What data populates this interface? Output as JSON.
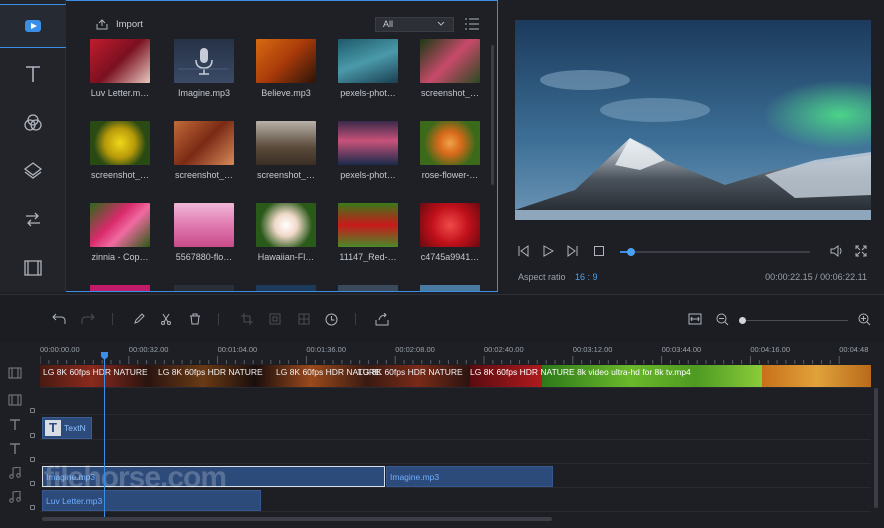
{
  "media": {
    "import_label": "Import",
    "filter": "All",
    "items": [
      {
        "name": "Luv Letter.m…"
      },
      {
        "name": "Imagine.mp3"
      },
      {
        "name": "Believe.mp3"
      },
      {
        "name": "pexels-phot…"
      },
      {
        "name": "screenshot_…"
      },
      {
        "name": "screenshot_…"
      },
      {
        "name": "screenshot_…"
      },
      {
        "name": "screenshot_…"
      },
      {
        "name": "pexels-phot…"
      },
      {
        "name": "rose-flower-…"
      },
      {
        "name": "zinnia - Cop…"
      },
      {
        "name": "5567880-flo…"
      },
      {
        "name": "Hawaiian-Fl…"
      },
      {
        "name": "11147_Red-…"
      },
      {
        "name": "c4745a9941…"
      }
    ]
  },
  "preview": {
    "aspect_label": "Aspect ratio",
    "aspect_value": "16 : 9",
    "timecode": "00:00:22.15 / 00:06:22.11",
    "progress_fraction": 0.06
  },
  "timeline": {
    "ruler": [
      "00:00:00.00",
      "00:00:32.00",
      "00:01:04.00",
      "00:01:36.00",
      "00:02:08.00",
      "00:02:40.00",
      "00:03:12.00",
      "00:03:44.00",
      "00:04:16.00",
      "00:04:48"
    ],
    "video_clip_title": "LG 8K 60fps HDR NATURE 8k video ultra-hd for 8k tv.mp4",
    "video_clip_title_short": "LG 8K 60fps HDR NATURE",
    "text_clip": "TextN",
    "audio_clips": [
      "Imagine.mp3",
      "Imagine.mp3",
      "Luv Letter.mp3"
    ]
  },
  "watermark": "filehorse.com",
  "colors": {
    "accent": "#3a8ee6",
    "background": "#1d1f24"
  }
}
